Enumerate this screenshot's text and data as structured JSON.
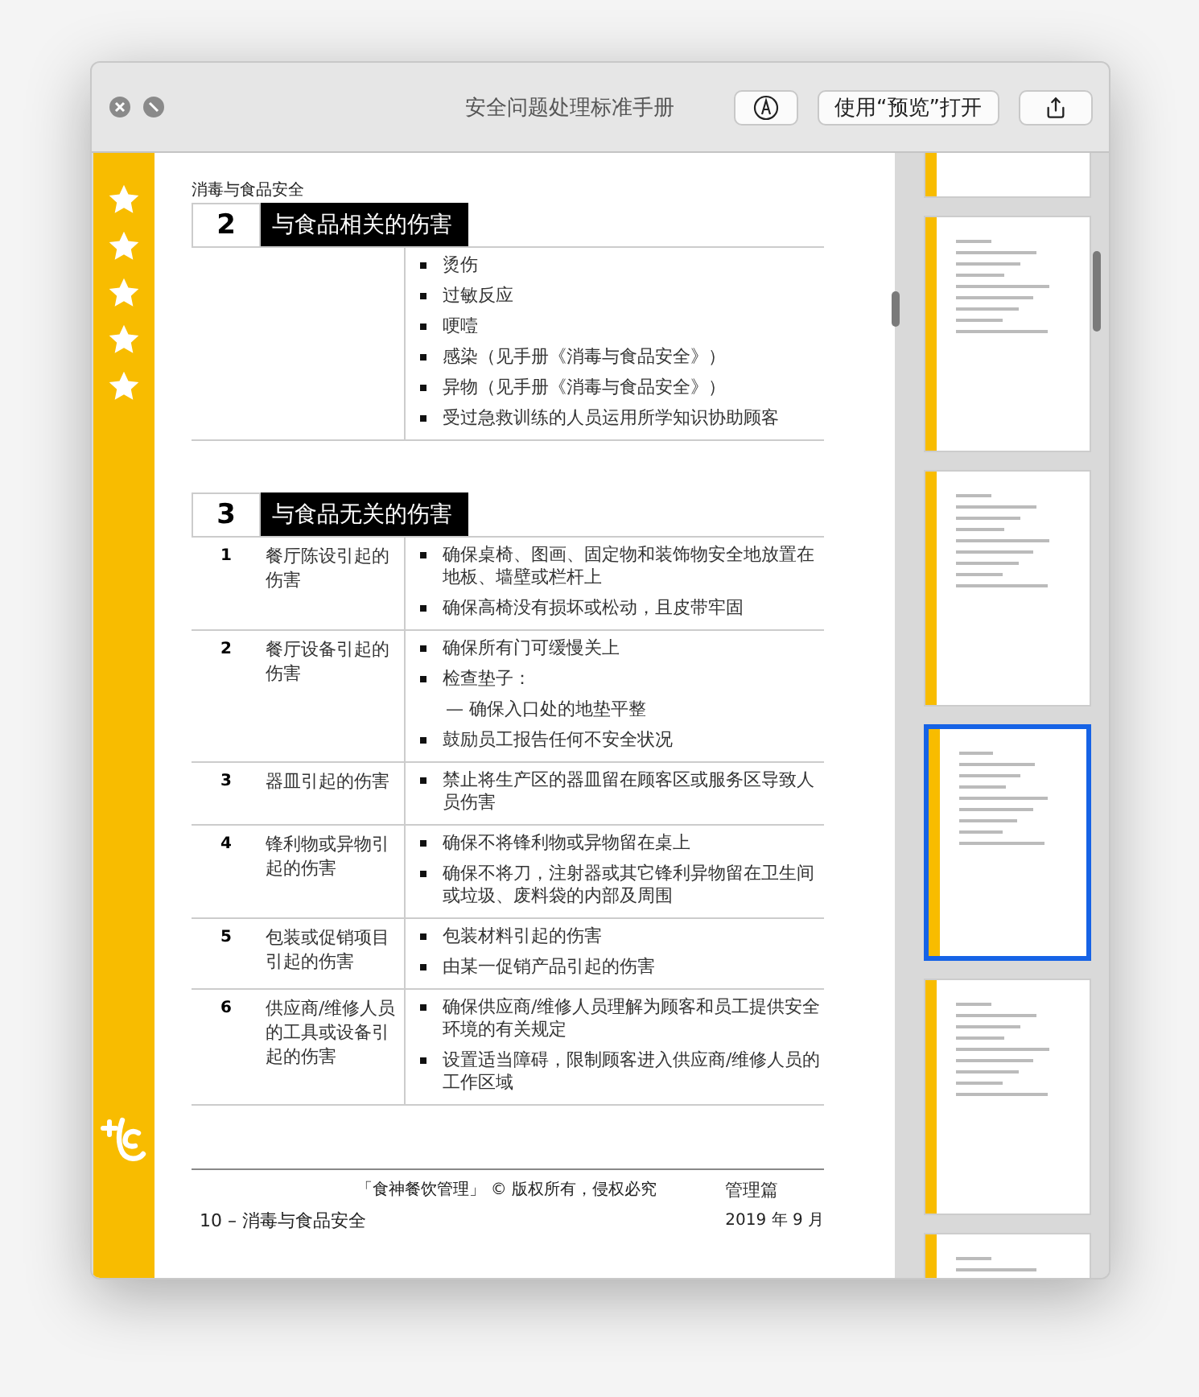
{
  "window": {
    "title": "安全问题处理标准手册",
    "buttons": [
      {
        "kind": "markup"
      },
      {
        "kind": "text",
        "label": "使用“预览”打开"
      },
      {
        "kind": "share"
      }
    ]
  },
  "page": {
    "section_label": "消毒与食品安全",
    "sections": [
      {
        "number": "2",
        "title": "与食品相关的伤害",
        "rows": [
          {
            "items": [
              {
                "kind": "bullet",
                "text": "烫伤"
              },
              {
                "kind": "bullet",
                "text": "过敏反应"
              },
              {
                "kind": "bullet",
                "text": "哽噎"
              },
              {
                "kind": "bullet",
                "text": "感染（见手册《消毒与食品安全》）"
              },
              {
                "kind": "bullet",
                "text": "异物（见手册《消毒与食品安全》）"
              },
              {
                "kind": "bullet",
                "text": "受过急救训练的人员运用所学知识协助顾客"
              }
            ]
          }
        ]
      },
      {
        "number": "3",
        "title": "与食品无关的伤害",
        "rows": [
          {
            "number": "1",
            "label": "餐厅陈设引起的伤害",
            "items": [
              {
                "kind": "bullet",
                "text": "确保桌椅、图画、固定物和装饰物安全地放置在地板、墙壁或栏杆上"
              },
              {
                "kind": "bullet",
                "text": "确保高椅没有损坏或松动，且皮带牢固"
              }
            ]
          },
          {
            "number": "2",
            "label": "餐厅设备引起的伤害",
            "items": [
              {
                "kind": "bullet",
                "text": "确保所有门可缓慢关上"
              },
              {
                "kind": "bullet",
                "text": "检查垫子："
              },
              {
                "kind": "dash",
                "text": "— 确保入口处的地垫平整"
              },
              {
                "kind": "bullet",
                "text": "鼓励员工报告任何不安全状况"
              }
            ]
          },
          {
            "number": "3",
            "label": "器皿引起的伤害",
            "items": [
              {
                "kind": "bullet",
                "text": "禁止将生产区的器皿留在顾客区或服务区导致人员伤害"
              }
            ]
          },
          {
            "number": "4",
            "label": "锋利物或异物引起的伤害",
            "items": [
              {
                "kind": "bullet",
                "text": "确保不将锋利物或异物留在桌上"
              },
              {
                "kind": "bullet",
                "text": "确保不将刀，注射器或其它锋利异物留在卫生间或垃圾、废料袋的内部及周围"
              }
            ]
          },
          {
            "number": "5",
            "label": "包装或促销项目引起的伤害",
            "items": [
              {
                "kind": "bullet",
                "text": "包装材料引起的伤害"
              },
              {
                "kind": "bullet",
                "text": "由某一促销产品引起的伤害"
              }
            ]
          },
          {
            "number": "6",
            "label": "供应商/维修人员的工具或设备引起的伤害",
            "items": [
              {
                "kind": "bullet",
                "text": "确保供应商/维修人员理解为顾客和员工提供安全环境的有关规定"
              },
              {
                "kind": "bullet",
                "text": "设置适当障碍，限制顾客进入供应商/维修人员的工作区域"
              }
            ]
          }
        ]
      }
    ],
    "footer": {
      "copyright": "「食神餐饮管理」 © 版权所有，侵权必究",
      "part": "管理篇",
      "page_label": "10 – 消毒与食品安全",
      "date": "2019 年 9 月"
    }
  },
  "thumbnails": [
    {
      "selected": false
    },
    {
      "selected": false
    },
    {
      "selected": false
    },
    {
      "selected": true
    },
    {
      "selected": false
    },
    {
      "selected": false
    }
  ]
}
